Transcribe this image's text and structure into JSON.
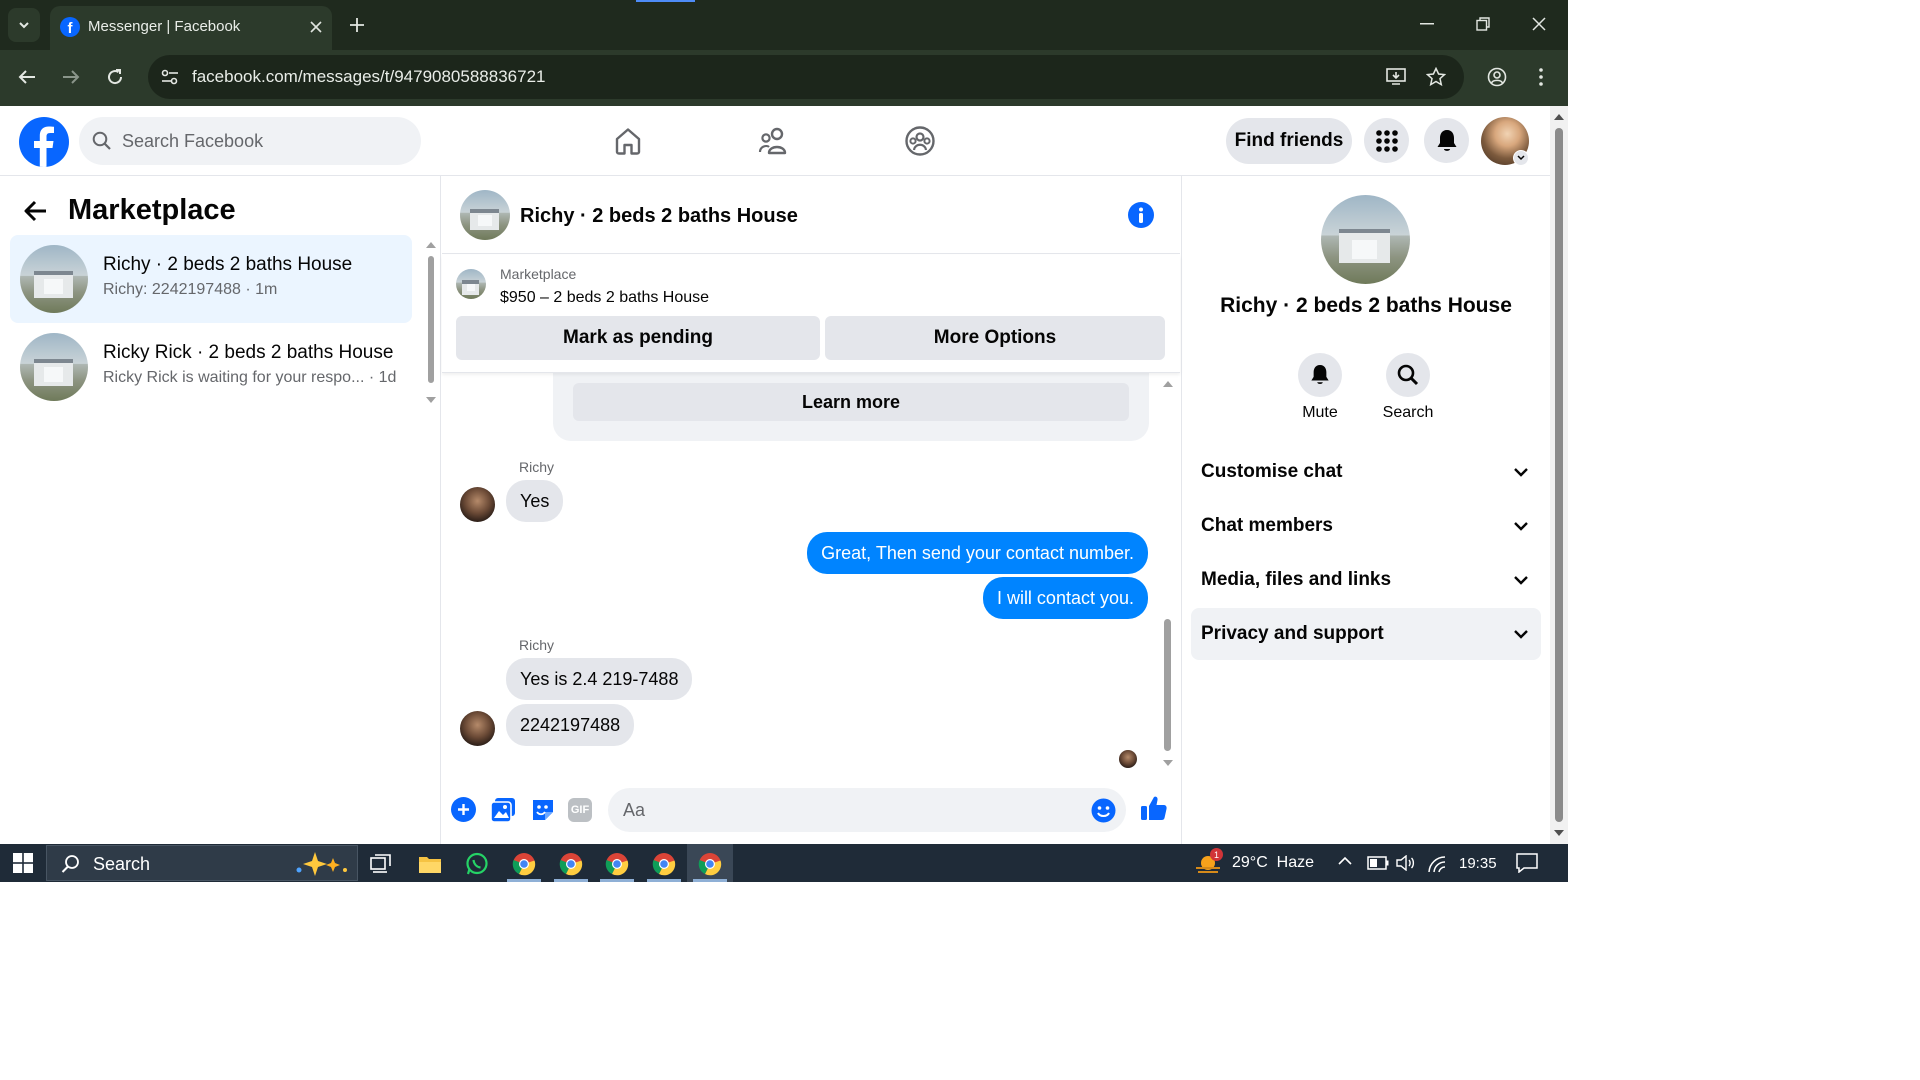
{
  "browser": {
    "tab_title": "Messenger | Facebook",
    "url": "facebook.com/messages/t/9479080588836721"
  },
  "header": {
    "search_placeholder": "Search Facebook",
    "find_friends": "Find friends"
  },
  "left": {
    "title": "Marketplace",
    "conversations": [
      {
        "name": "Richy · 2 beds 2 baths House",
        "preview": "Richy: 2242197488 · 1m",
        "active": true
      },
      {
        "name": "Ricky Rick · 2 beds 2 baths House",
        "preview": "Ricky Rick is waiting for your respo... · 1d",
        "active": false
      }
    ]
  },
  "chat": {
    "title": "Richy · 2 beds 2 baths House",
    "listing_source": "Marketplace",
    "listing_text": "$950 – 2 beds 2 baths House",
    "mark_pending": "Mark as pending",
    "more_options": "More Options",
    "learn_more": "Learn more",
    "sender1": "Richy",
    "msg1": "Yes",
    "out1": "Great, Then send your contact number.",
    "out2": "I will contact you.",
    "sender2": "Richy",
    "msg2": "Yes is 2.4 219-7488",
    "msg3": "2242197488",
    "composer_placeholder": "Aa"
  },
  "right": {
    "name": "Richy · 2 beds 2 baths House",
    "mute": "Mute",
    "search": "Search",
    "sections": [
      "Customise chat",
      "Chat members",
      "Media, files and links",
      "Privacy and support"
    ]
  },
  "taskbar": {
    "search": "Search",
    "weather": "29°C  Haze",
    "time": "19:35",
    "weather_badge": "1"
  },
  "colors": {
    "accent": "#0866ff",
    "bubble_out": "#0084ff"
  }
}
